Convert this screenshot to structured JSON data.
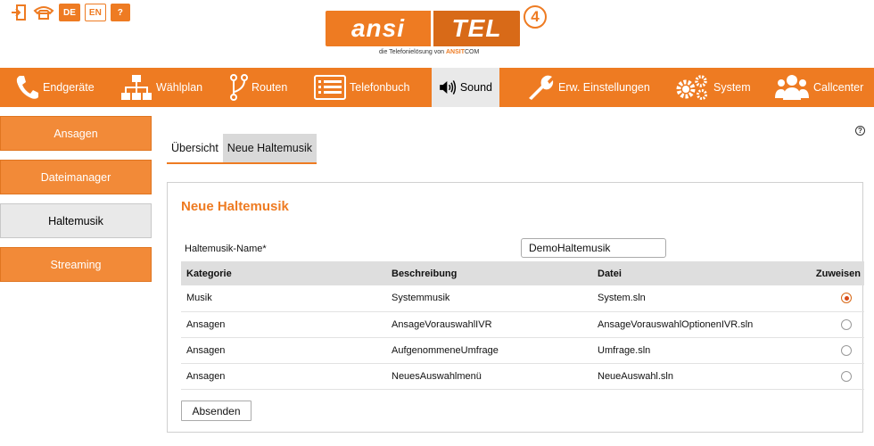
{
  "top_icons": {
    "lang_de": "DE",
    "lang_en": "EN",
    "help": "?",
    "logout_icon": "logout-icon",
    "phone_icon": "phone-icon"
  },
  "logo": {
    "part1": "ansi",
    "part2": "TEL",
    "version": "4",
    "tagline_prefix": "die Telefonielösung von",
    "tagline_brand": "ANSIT",
    "tagline_suffix": "COM"
  },
  "nav": [
    {
      "label": "Endgeräte",
      "icon": "phone-icon"
    },
    {
      "label": "Wählplan",
      "icon": "hierarchy-icon"
    },
    {
      "label": "Routen",
      "icon": "route-icon"
    },
    {
      "label": "Telefonbuch",
      "icon": "list-icon"
    },
    {
      "label": "Sound",
      "icon": "speaker-icon"
    },
    {
      "label": "Erw. Einstellungen",
      "icon": "wrench-icon"
    },
    {
      "label": "System",
      "icon": "gears-icon"
    },
    {
      "label": "Callcenter",
      "icon": "users-icon"
    }
  ],
  "nav_active": "Sound",
  "side": [
    "Ansagen",
    "Dateimanager",
    "Haltemusik",
    "Streaming"
  ],
  "side_active": "Haltemusik",
  "subtabs": [
    "Übersicht",
    "Neue Haltemusik"
  ],
  "subtab_active": "Neue Haltemusik",
  "panel": {
    "title": "Neue Haltemusik",
    "name_label": "Haltemusik-Name*",
    "name_value": "DemoHaltemusik",
    "columns": [
      "Kategorie",
      "Beschreibung",
      "Datei",
      "Zuweisen"
    ],
    "rows": [
      {
        "kategorie": "Musik",
        "beschreibung": "Systemmusik",
        "datei": "System.sln",
        "selected": true
      },
      {
        "kategorie": "Ansagen",
        "beschreibung": "AnsageVorauswahlIVR",
        "datei": "AnsageVorauswahlOptionenIVR.sln",
        "selected": false
      },
      {
        "kategorie": "Ansagen",
        "beschreibung": "AufgenommeneUmfrage",
        "datei": "Umfrage.sln",
        "selected": false
      },
      {
        "kategorie": "Ansagen",
        "beschreibung": "NeuesAuswahlmenü",
        "datei": "NeueAuswahl.sln",
        "selected": false
      }
    ],
    "submit": "Absenden"
  },
  "colors": {
    "accent": "#ee7b22",
    "active_bg": "#e9e9e9"
  }
}
